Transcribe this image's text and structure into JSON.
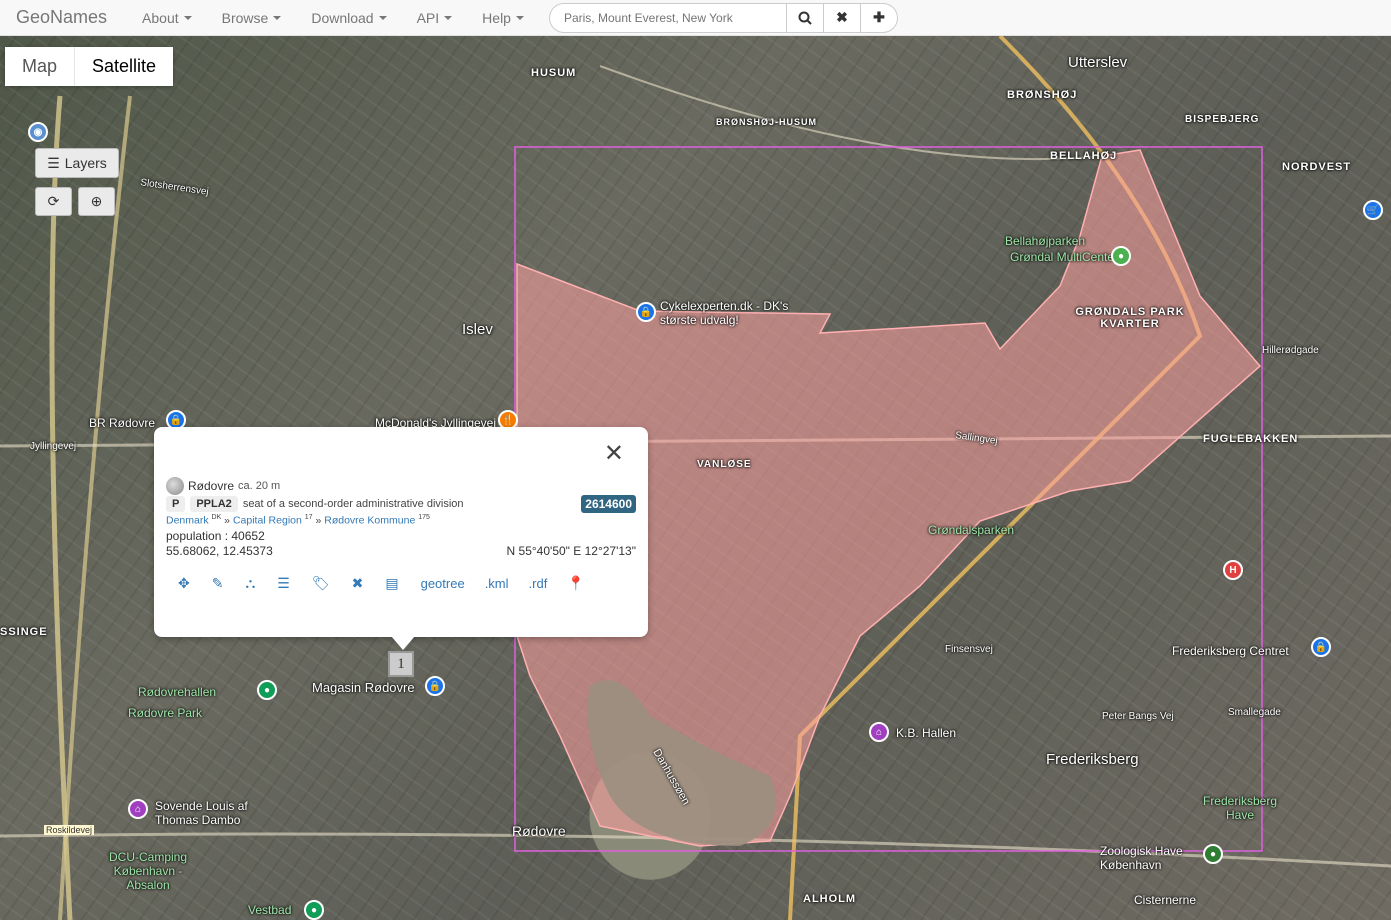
{
  "navbar": {
    "brand": "GeoNames",
    "items": [
      "About",
      "Browse",
      "Download",
      "API",
      "Help"
    ],
    "search_placeholder": "Paris, Mount Everest, New York"
  },
  "map_controls": {
    "map_label": "Map",
    "satellite_label": "Satellite",
    "layers_label": "Layers"
  },
  "popup": {
    "name": "Rødovre",
    "elevation": "ca. 20 m",
    "class": "P",
    "code": "PPLA2",
    "description": "seat of a second-order administrative division",
    "geonameid": "2614600",
    "hierarchy": {
      "country": "Denmark",
      "country_sup": "DK",
      "region": "Capital Region",
      "region_sup": "17",
      "kommune": "Rødovre Kommune",
      "kommune_sup": "175"
    },
    "population": "population : 40652",
    "latlon": "55.68062, 12.45373",
    "dms": "N 55°40'50\" E 12°27'13\"",
    "links": [
      "geotree",
      ".kml",
      ".rdf"
    ]
  },
  "cluster_marker": "1",
  "map_labels": [
    "HUSUM",
    "Utterslev",
    "BRØNSHØJ",
    "BRØNSHØJ-HUSUM",
    "BISPEBJERG",
    "BELLAHØJ",
    "NORDVEST",
    "Bellahøjparken",
    "Grøndal MultiCenter",
    "GRØNDALS PARK KVARTER",
    "Cykelexperten.dk - DK's største udvalg!",
    "Islev",
    "Slotsherrensvej",
    "BR Rødovre",
    "McDonald's Jyllingevej",
    "Jyllingevej",
    "VANLØSE",
    "Hillerødgade",
    "FUGLEBAKKEN",
    "Sallingvej",
    "Grøndalsparken",
    "Rødovrehallen",
    "Magasin Rødovre",
    "Rødovre Park",
    "Finsensvej",
    "Frederiksberg Centret",
    "K.B. Hallen",
    "Peter Bangs Vej",
    "Smallegade",
    "Frederiksberg",
    "Frederiksberg Have",
    "Danhussøen",
    "Rødovre",
    "Sovende Louis af Thomas Dambo",
    "DCU-Camping København - Absalon",
    "Roskildevej",
    "Zoologisk Have København",
    "Cisternerne",
    "Vestbad",
    "ALHOLM",
    "SSINGE",
    "Layers"
  ]
}
